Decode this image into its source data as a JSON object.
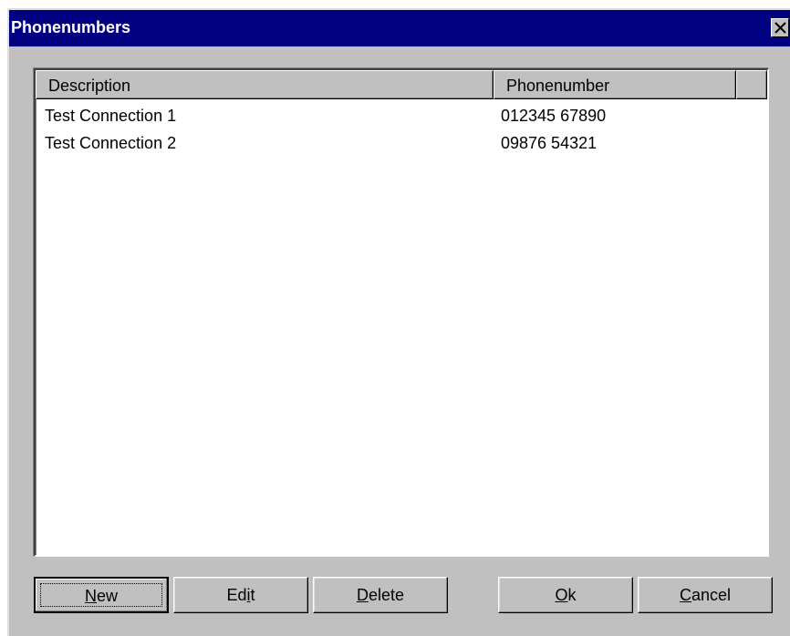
{
  "window": {
    "title": "Phonenumbers"
  },
  "list": {
    "columns": [
      "Description",
      "Phonenumber",
      ""
    ],
    "rows": [
      {
        "description": "Test Connection 1",
        "phonenumber": "012345 67890"
      },
      {
        "description": "Test Connection 2",
        "phonenumber": "09876 54321"
      }
    ]
  },
  "buttons": {
    "new": {
      "pre": "",
      "mnemonic": "N",
      "post": "ew"
    },
    "edit": {
      "pre": "Ed",
      "mnemonic": "i",
      "post": "t"
    },
    "delete": {
      "pre": "",
      "mnemonic": "D",
      "post": "elete"
    },
    "ok": {
      "pre": "",
      "mnemonic": "O",
      "post": "k"
    },
    "cancel": {
      "pre": "",
      "mnemonic": "C",
      "post": "ancel"
    }
  },
  "icons": {
    "close": "close-icon"
  },
  "colors": {
    "titlebar": "#000080",
    "face": "#c0c0c0"
  }
}
